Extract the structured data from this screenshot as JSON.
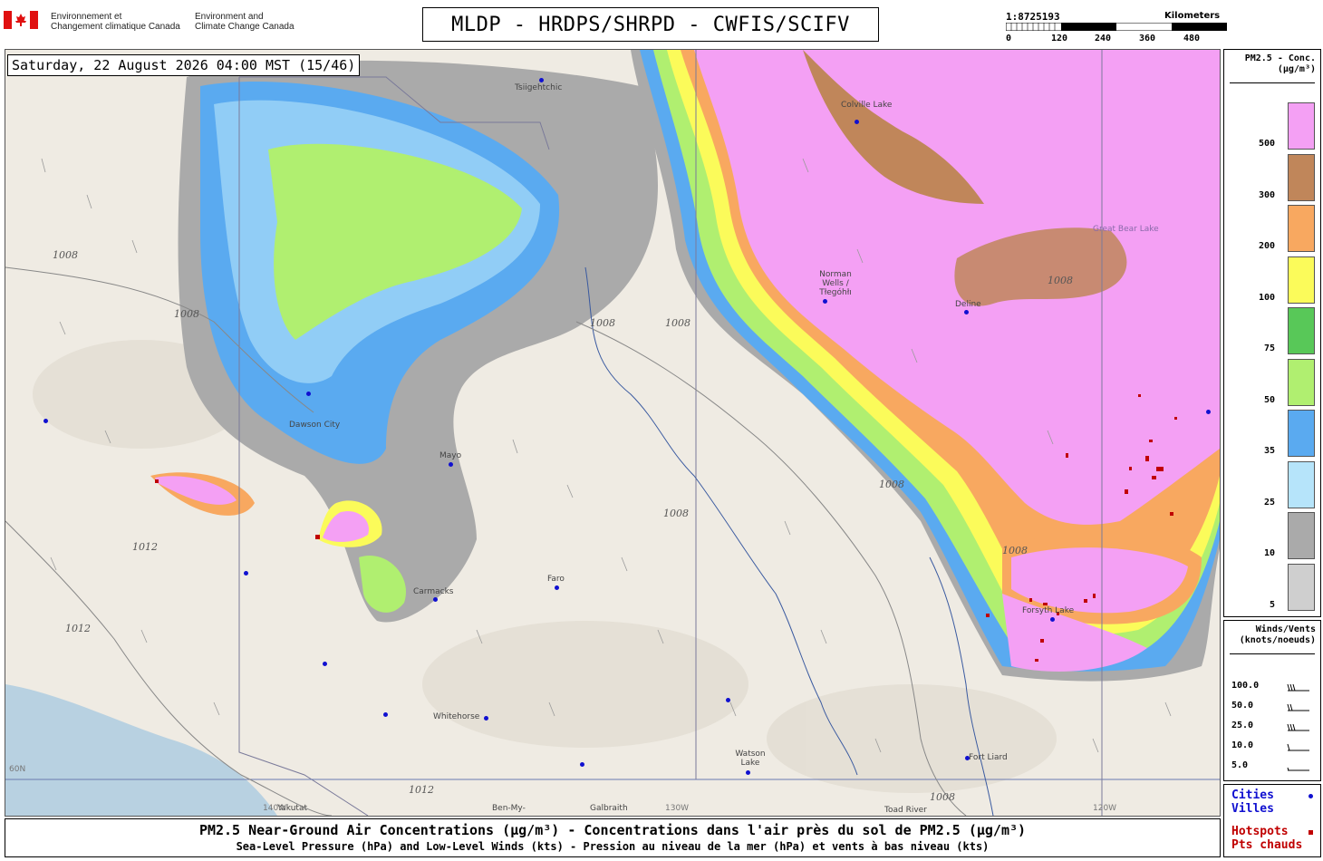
{
  "header": {
    "agency_fr_line1": "Environnement et",
    "agency_fr_line2": "Changement climatique Canada",
    "agency_en_line1": "Environment and",
    "agency_en_line2": "Climate Change Canada",
    "product_title": "MLDP - HRDPS/SHRPD - CWFIS/SCIFV"
  },
  "scale": {
    "ratio": "1:8725193",
    "unit": "Kilometers",
    "ticks": [
      "0",
      "120",
      "240",
      "360",
      "480"
    ]
  },
  "map": {
    "timestamp": "Saturday, 22 August 2026 04:00 MST (15/46)",
    "cities": [
      {
        "name": "Tsiigehtchic"
      },
      {
        "name": "Colville Lake"
      },
      {
        "name": "Norman Wells / Tłegóhłı"
      },
      {
        "name": "Deline"
      },
      {
        "name": "Dawson City"
      },
      {
        "name": "Mayo"
      },
      {
        "name": "Faro"
      },
      {
        "name": "Carmacks"
      },
      {
        "name": "Whitehorse"
      },
      {
        "name": "Watson Lake"
      },
      {
        "name": "Fort Liard"
      },
      {
        "name": "Forsyth Lake"
      },
      {
        "name": "Yakutat"
      },
      {
        "name": "Ben-My-"
      },
      {
        "name": "Galbraith"
      },
      {
        "name": "Toad River"
      }
    ],
    "features": {
      "great_bear": "Great Bear Lake",
      "lon_130": "130W",
      "lon_120": "120W",
      "lon_140": "140W",
      "lat_60": "60N"
    },
    "isobars": [
      "1008",
      "1012"
    ]
  },
  "legend": {
    "pm_title_line1": "PM2.5 - Conc.",
    "pm_title_line2": "(µg/m³)",
    "pm_bins": [
      {
        "value": "500",
        "color": "#f4a0f4"
      },
      {
        "value": "300",
        "color": "#c0865a"
      },
      {
        "value": "200",
        "color": "#f8a860"
      },
      {
        "value": "100",
        "color": "#fbfb5a"
      },
      {
        "value": "75",
        "color": "#58c858"
      },
      {
        "value": "50",
        "color": "#b0ef70"
      },
      {
        "value": "35",
        "color": "#5aaaf0"
      },
      {
        "value": "25",
        "color": "#b6e4fa"
      },
      {
        "value": "10",
        "color": "#aaaaaa"
      },
      {
        "value": "5",
        "color": "#cfcfcf"
      }
    ],
    "wind_title_line1": "Winds/Vents",
    "wind_title_line2": "(knots/noeuds)",
    "wind_values": [
      "100.0",
      "50.0",
      "25.0",
      "10.0",
      "5.0"
    ],
    "cities_en": "Cities",
    "cities_fr": "Villes",
    "hotspots_en": "Hotspots",
    "hotspots_fr": "Pts chauds",
    "city_color": "#1010d0",
    "hotspot_color": "#c00000"
  },
  "footer": {
    "line1": "PM2.5 Near-Ground Air Concentrations (µg/m³) - Concentrations dans l'air près du sol de PM2.5 (µg/m³)",
    "line2": "Sea-Level Pressure (hPa) and Low-Level Winds (kts) - Pression au niveau de la mer (hPa) et vents à bas niveau (kts)"
  }
}
